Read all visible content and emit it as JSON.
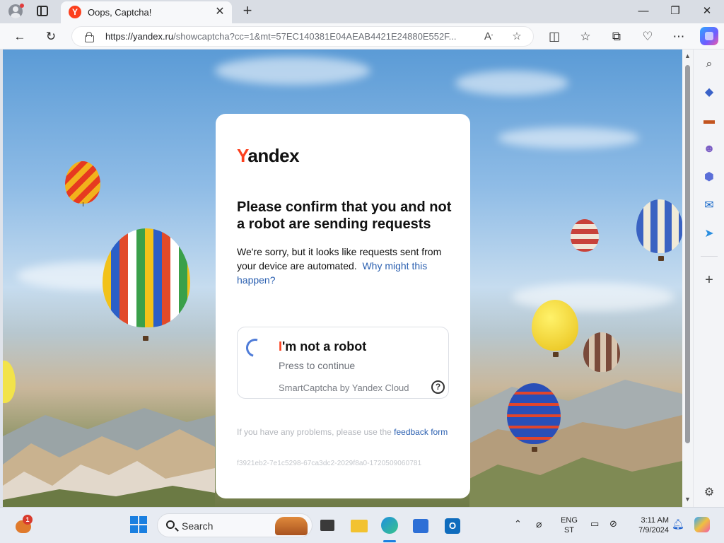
{
  "browser": {
    "tab_title": "Oops, Captcha!",
    "tab_favicon_letter": "Y",
    "url_host": "https://yandex.ru",
    "url_rest": "/showcaptcha?cc=1&mt=57EC140381E04AEAB4421E24880E552F...",
    "icons": {
      "profile": "profile-avatar-icon",
      "tab_actions": "tab-actions-icon",
      "new_tab": "plus-icon",
      "minimize": "minimize-icon",
      "restore": "restore-icon",
      "close": "close-icon",
      "back": "back-arrow-icon",
      "refresh": "refresh-icon",
      "read_aloud": "read-aloud-icon",
      "favorite": "star-icon",
      "split": "split-screen-icon",
      "favorites": "favorites-icon",
      "collections": "collections-icon",
      "performance": "heart-pulse-icon",
      "more": "more-icon",
      "copilot": "copilot-icon"
    }
  },
  "captcha": {
    "logo_first": "Y",
    "logo_rest": "andex",
    "heading": "Please confirm that you and not a robot are sending requests",
    "description": "We're sorry, but it looks like requests sent from your device are automated.",
    "why_link": "Why might this happen?",
    "robot_check": {
      "title_first": "I",
      "title_rest": "'m not a robot",
      "subtitle": "Press to continue",
      "brand": "SmartCaptcha by Yandex Cloud",
      "help": "?"
    },
    "problems_text": "If you have any problems, please use the",
    "feedback_link": "feedback form",
    "request_id": "f3921eb2-7e1c5298-67ca3dc2-2029f8a0-1720509060781"
  },
  "taskbar": {
    "search_label": "Search",
    "language_line1": "ENG",
    "language_line2": "ST",
    "time": "3:11 AM",
    "date": "7/9/2024",
    "notification_count": "1"
  },
  "colors": {
    "yandex_red": "#fc3f1d",
    "link_blue": "#2a5fb0",
    "windows_blue": "#1a7fe0"
  }
}
